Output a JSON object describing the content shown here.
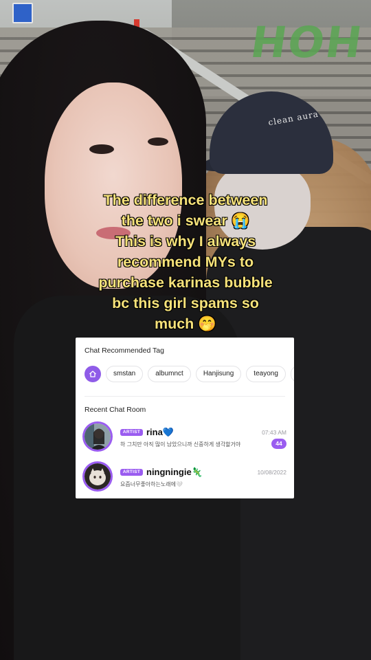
{
  "caption": {
    "lines": [
      "The difference between",
      "the two i swear 😭",
      "This is why I always",
      "recommend MYs to",
      "purchase karinas bubble",
      "bc this girl spams so",
      "much 🤭"
    ]
  },
  "background": {
    "graffiti_text": "HOH",
    "cap_text": "clean aura"
  },
  "bubble": {
    "recommended_title": "Chat Recommended Tag",
    "home_icon": "home-icon",
    "tags": [
      "smstan",
      "albumnct",
      "Hanjisung",
      "teayong"
    ],
    "recent_title": "Recent Chat Room",
    "rooms": [
      {
        "badge": "ARTIST",
        "name": "rina💙",
        "message": "하 그치만 아직 많이 남았으니까 신중하게 생각할거야",
        "time": "07:43 AM",
        "unread": "44"
      },
      {
        "badge": "ARTIST",
        "name": "ningningie🦎",
        "message": "요즘너무좋아하는노래에🤍",
        "time": "10/08/2022"
      }
    ],
    "accent_color": "#9a5cf0"
  }
}
